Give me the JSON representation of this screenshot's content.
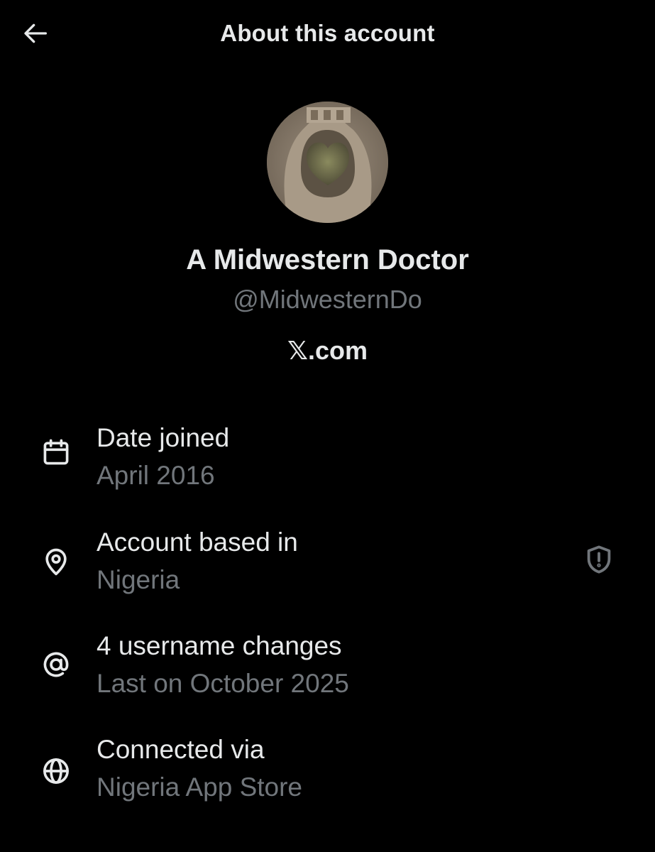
{
  "header": {
    "title": "About this account",
    "back_icon": "arrow-left-icon"
  },
  "profile": {
    "display_name": "A Midwestern Doctor",
    "handle": "@MidwesternDo",
    "platform": "𝕏.com"
  },
  "info_rows": [
    {
      "icon": "calendar-icon",
      "title": "Date joined",
      "subtitle": "April 2016"
    },
    {
      "icon": "location-pin-icon",
      "title": "Account based in",
      "subtitle": "Nigeria",
      "trailing_icon": "shield-alert-icon"
    },
    {
      "icon": "at-sign-icon",
      "title": "4 username changes",
      "subtitle": "Last on October 2025"
    },
    {
      "icon": "globe-icon",
      "title": "Connected via",
      "subtitle": "Nigeria App Store"
    }
  ],
  "colors": {
    "background": "#000000",
    "primary_text": "#e7e9ea",
    "secondary_text": "#71767b"
  }
}
